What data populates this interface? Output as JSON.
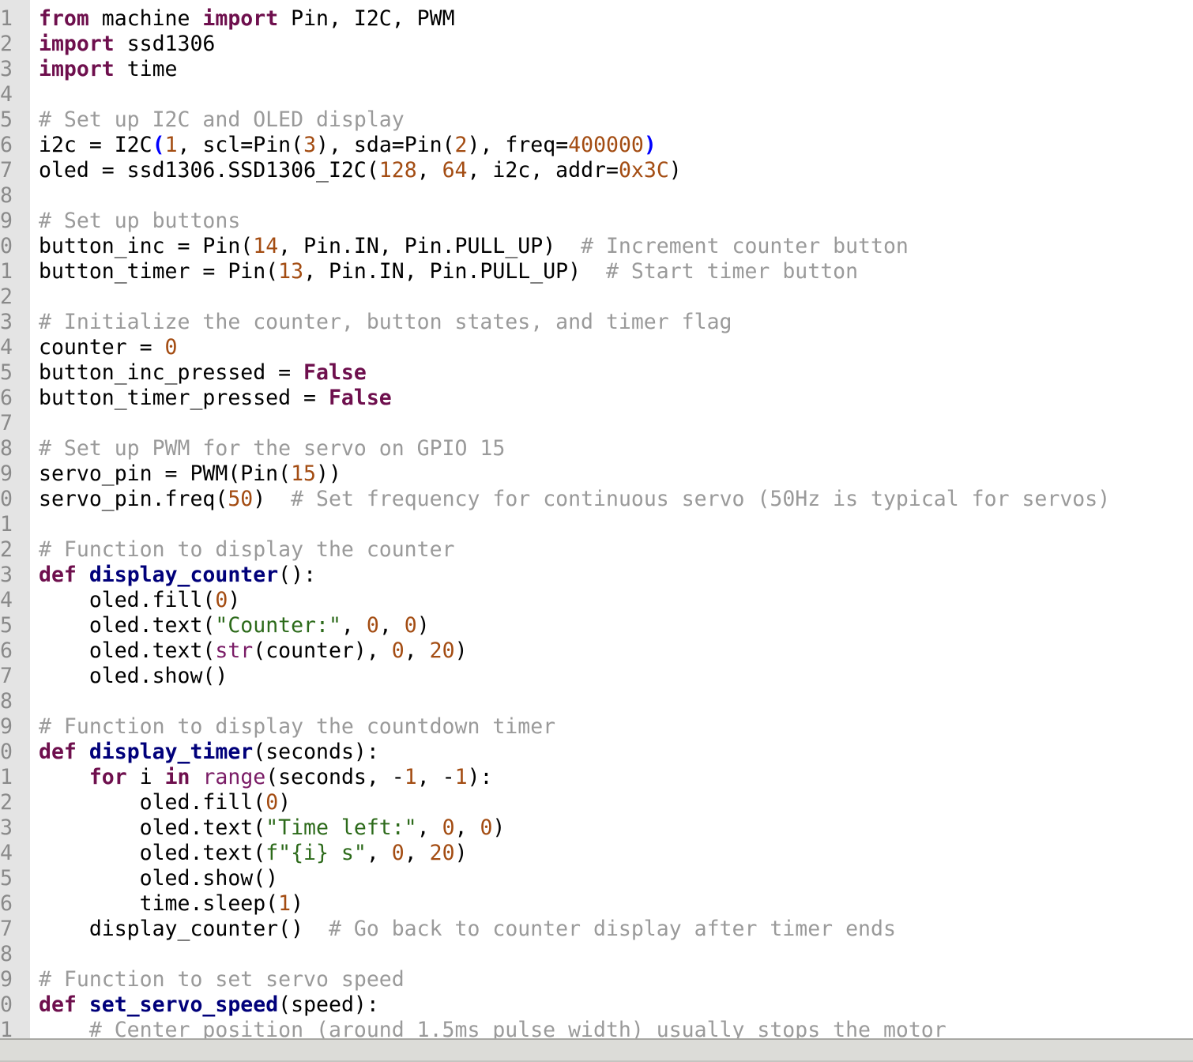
{
  "colors": {
    "keyword": "#6e0f4d",
    "function": "#00007a",
    "number": "#a34c12",
    "comment": "#9a9a9a",
    "string": "#2c6a1a",
    "builtin": "#7a1c66",
    "bracket_match": "#0000ff",
    "gutter": "#e4e4e4"
  },
  "lines": [
    {
      "num": "1",
      "tokens": [
        [
          "k",
          "from"
        ],
        [
          "p",
          " machine "
        ],
        [
          "k",
          "import"
        ],
        [
          "p",
          " Pin, I2C, PWM"
        ]
      ]
    },
    {
      "num": "2",
      "tokens": [
        [
          "k",
          "import"
        ],
        [
          "p",
          " ssd1306"
        ]
      ]
    },
    {
      "num": "3",
      "tokens": [
        [
          "k",
          "import"
        ],
        [
          "p",
          " time"
        ]
      ]
    },
    {
      "num": "4",
      "tokens": []
    },
    {
      "num": "5",
      "tokens": [
        [
          "c",
          "# Set up I2C and OLED display"
        ]
      ]
    },
    {
      "num": "6",
      "tokens": [
        [
          "p",
          "i2c = I2C"
        ],
        [
          "m",
          "("
        ],
        [
          "n",
          "1"
        ],
        [
          "p",
          ", scl=Pin("
        ],
        [
          "n",
          "3"
        ],
        [
          "p",
          "), sda=Pin("
        ],
        [
          "n",
          "2"
        ],
        [
          "p",
          "), freq="
        ],
        [
          "n",
          "400000"
        ],
        [
          "m",
          ")"
        ]
      ]
    },
    {
      "num": "7",
      "tokens": [
        [
          "p",
          "oled = ssd1306.SSD1306_I2C("
        ],
        [
          "n",
          "128"
        ],
        [
          "p",
          ", "
        ],
        [
          "n",
          "64"
        ],
        [
          "p",
          ", i2c, addr="
        ],
        [
          "n",
          "0x3C"
        ],
        [
          "p",
          ")"
        ]
      ]
    },
    {
      "num": "8",
      "tokens": []
    },
    {
      "num": "9",
      "tokens": [
        [
          "c",
          "# Set up buttons"
        ]
      ]
    },
    {
      "num": "0",
      "tokens": [
        [
          "p",
          "button_inc = Pin("
        ],
        [
          "n",
          "14"
        ],
        [
          "p",
          ", Pin.IN, Pin.PULL_UP)  "
        ],
        [
          "c",
          "# Increment counter button"
        ]
      ]
    },
    {
      "num": "1",
      "tokens": [
        [
          "p",
          "button_timer = Pin("
        ],
        [
          "n",
          "13"
        ],
        [
          "p",
          ", Pin.IN, Pin.PULL_UP)  "
        ],
        [
          "c",
          "# Start timer button"
        ]
      ]
    },
    {
      "num": "2",
      "tokens": []
    },
    {
      "num": "3",
      "tokens": [
        [
          "c",
          "# Initialize the counter, button states, and timer flag"
        ]
      ]
    },
    {
      "num": "4",
      "tokens": [
        [
          "p",
          "counter = "
        ],
        [
          "n",
          "0"
        ]
      ]
    },
    {
      "num": "5",
      "tokens": [
        [
          "p",
          "button_inc_pressed = "
        ],
        [
          "k",
          "False"
        ]
      ]
    },
    {
      "num": "6",
      "tokens": [
        [
          "p",
          "button_timer_pressed = "
        ],
        [
          "k",
          "False"
        ]
      ]
    },
    {
      "num": "7",
      "tokens": []
    },
    {
      "num": "8",
      "tokens": [
        [
          "c",
          "# Set up PWM for the servo on GPIO 15"
        ]
      ]
    },
    {
      "num": "9",
      "tokens": [
        [
          "p",
          "servo_pin = PWM(Pin("
        ],
        [
          "n",
          "15"
        ],
        [
          "p",
          "))"
        ]
      ]
    },
    {
      "num": "0",
      "tokens": [
        [
          "p",
          "servo_pin.freq("
        ],
        [
          "n",
          "50"
        ],
        [
          "p",
          ")  "
        ],
        [
          "c",
          "# Set frequency for continuous servo (50Hz is typical for servos)"
        ]
      ]
    },
    {
      "num": "1",
      "tokens": []
    },
    {
      "num": "2",
      "tokens": [
        [
          "c",
          "# Function to display the counter"
        ]
      ]
    },
    {
      "num": "3",
      "tokens": [
        [
          "k",
          "def"
        ],
        [
          "p",
          " "
        ],
        [
          "f",
          "display_counter"
        ],
        [
          "p",
          "():"
        ]
      ]
    },
    {
      "num": "4",
      "tokens": [
        [
          "p",
          "    oled.fill("
        ],
        [
          "n",
          "0"
        ],
        [
          "p",
          ")"
        ]
      ]
    },
    {
      "num": "5",
      "tokens": [
        [
          "p",
          "    oled.text("
        ],
        [
          "s",
          "\"Counter:\""
        ],
        [
          "p",
          ", "
        ],
        [
          "n",
          "0"
        ],
        [
          "p",
          ", "
        ],
        [
          "n",
          "0"
        ],
        [
          "p",
          ")"
        ]
      ]
    },
    {
      "num": "6",
      "tokens": [
        [
          "p",
          "    oled.text("
        ],
        [
          "b",
          "str"
        ],
        [
          "p",
          "(counter), "
        ],
        [
          "n",
          "0"
        ],
        [
          "p",
          ", "
        ],
        [
          "n",
          "20"
        ],
        [
          "p",
          ")"
        ]
      ]
    },
    {
      "num": "7",
      "tokens": [
        [
          "p",
          "    oled.show()"
        ]
      ]
    },
    {
      "num": "8",
      "tokens": []
    },
    {
      "num": "9",
      "tokens": [
        [
          "c",
          "# Function to display the countdown timer"
        ]
      ]
    },
    {
      "num": "0",
      "tokens": [
        [
          "k",
          "def"
        ],
        [
          "p",
          " "
        ],
        [
          "f",
          "display_timer"
        ],
        [
          "p",
          "(seconds):"
        ]
      ]
    },
    {
      "num": "1",
      "tokens": [
        [
          "p",
          "    "
        ],
        [
          "k",
          "for"
        ],
        [
          "p",
          " i "
        ],
        [
          "k",
          "in"
        ],
        [
          "p",
          " "
        ],
        [
          "b",
          "range"
        ],
        [
          "p",
          "(seconds, -"
        ],
        [
          "n",
          "1"
        ],
        [
          "p",
          ", -"
        ],
        [
          "n",
          "1"
        ],
        [
          "p",
          "):"
        ]
      ]
    },
    {
      "num": "2",
      "tokens": [
        [
          "p",
          "        oled.fill("
        ],
        [
          "n",
          "0"
        ],
        [
          "p",
          ")"
        ]
      ]
    },
    {
      "num": "3",
      "tokens": [
        [
          "p",
          "        oled.text("
        ],
        [
          "s",
          "\"Time left:\""
        ],
        [
          "p",
          ", "
        ],
        [
          "n",
          "0"
        ],
        [
          "p",
          ", "
        ],
        [
          "n",
          "0"
        ],
        [
          "p",
          ")"
        ]
      ]
    },
    {
      "num": "4",
      "tokens": [
        [
          "p",
          "        oled.text("
        ],
        [
          "s",
          "f\"{i} s\""
        ],
        [
          "p",
          ", "
        ],
        [
          "n",
          "0"
        ],
        [
          "p",
          ", "
        ],
        [
          "n",
          "20"
        ],
        [
          "p",
          ")"
        ]
      ]
    },
    {
      "num": "5",
      "tokens": [
        [
          "p",
          "        oled.show()"
        ]
      ]
    },
    {
      "num": "6",
      "tokens": [
        [
          "p",
          "        time.sleep("
        ],
        [
          "n",
          "1"
        ],
        [
          "p",
          ")"
        ]
      ]
    },
    {
      "num": "7",
      "tokens": [
        [
          "p",
          "    display_counter()  "
        ],
        [
          "c",
          "# Go back to counter display after timer ends"
        ]
      ]
    },
    {
      "num": "8",
      "tokens": []
    },
    {
      "num": "9",
      "tokens": [
        [
          "c",
          "# Function to set servo speed"
        ]
      ]
    },
    {
      "num": "0",
      "tokens": [
        [
          "k",
          "def"
        ],
        [
          "p",
          " "
        ],
        [
          "f",
          "set_servo_speed"
        ],
        [
          "p",
          "(speed):"
        ]
      ]
    },
    {
      "num": "1",
      "tokens": [
        [
          "c",
          "    # Center position (around 1.5ms pulse width) usually stops the motor"
        ]
      ]
    }
  ]
}
